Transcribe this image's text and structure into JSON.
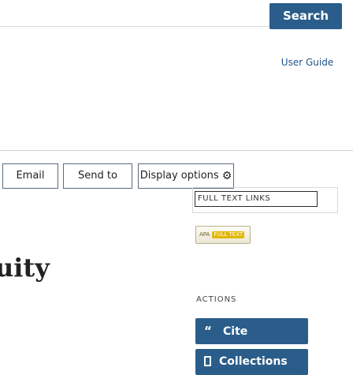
{
  "header": {
    "search_label": "Search",
    "user_guide": "User Guide"
  },
  "toolbar": {
    "email": "Email",
    "send_to": "Send to",
    "display_options": "Display options"
  },
  "sidebar": {
    "full_text_links_label": "FULL TEXT LINKS",
    "apa_logo": {
      "text": "APA",
      "tag": "FULL TEXT"
    },
    "actions_label": "ACTIONS",
    "cite_label": "Cite",
    "collections_label": "Collections"
  },
  "article": {
    "title_fragment": "uity"
  },
  "colors": {
    "primary": "#2b5d8a",
    "link": "#20558a"
  },
  "icons": {
    "display_options": "gear-icon",
    "cite": "quote-icon",
    "collections": "bookmark-icon"
  }
}
